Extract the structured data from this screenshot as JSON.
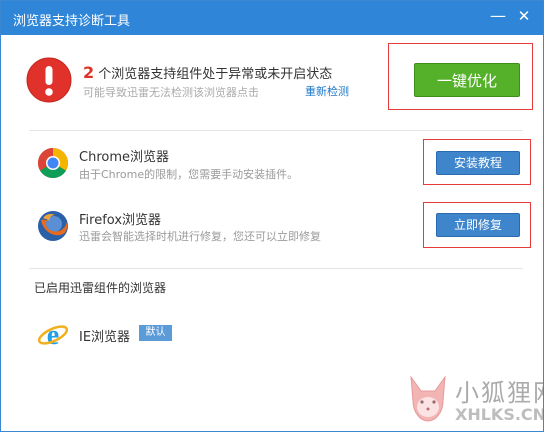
{
  "window": {
    "title": "浏览器支持诊断工具",
    "minimize_glyph": "—",
    "close_glyph": "✕"
  },
  "alert": {
    "count": "2",
    "message": " 个浏览器支持组件处于异常或未开启状态",
    "sub": "可能导致迅雷无法检测该浏览器点击",
    "redetect_link": "重新检测",
    "optimize_button": "一键优化",
    "icon": "exclamation-circle-icon",
    "color": "#e0322b"
  },
  "browsers": [
    {
      "name": "Chrome浏览器",
      "desc": "由于Chrome的限制，您需要手动安装插件。",
      "button": "安装教程",
      "icon": "chrome-icon"
    },
    {
      "name": "Firefox浏览器",
      "desc": "迅雷会智能选择时机进行修复，您还可以立即修复",
      "button": "立即修复",
      "icon": "firefox-icon"
    }
  ],
  "enabled": {
    "title": "已启用迅雷组件的浏览器",
    "items": [
      {
        "name": "IE浏览器",
        "badge": "默认",
        "icon": "ie-icon"
      }
    ]
  },
  "watermark": {
    "text_cn": "小狐狸网",
    "text_en": "XHLKS.CN",
    "icon": "fox-logo-icon"
  },
  "colors": {
    "titlebar": "#2f86d8",
    "green": "#55b02a",
    "blue": "#3f85cc",
    "highlight": "#e53b3b"
  }
}
